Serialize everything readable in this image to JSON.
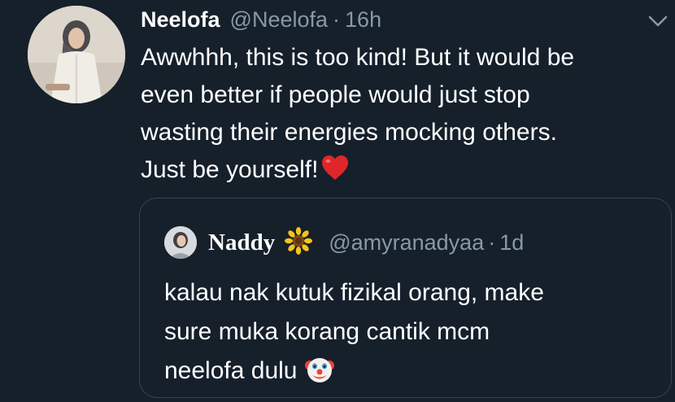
{
  "tweet": {
    "author_name": "Neelofa",
    "author_handle": "@Neelofa",
    "separator": "·",
    "time": "16h",
    "text_lines": [
      "Awwhhh, this is too kind! But it would be",
      "even better if people would just stop",
      "wasting their energies mocking others.",
      "Just be yourself!"
    ],
    "trailing_emoji": "heart-icon"
  },
  "quoted_tweet": {
    "author_name": "Naddy",
    "name_emoji": "sunflower-icon",
    "author_handle": "@amyranadyaa",
    "separator": "·",
    "time": "1d",
    "text_lines": [
      "kalau nak kutuk fizikal orang, make",
      "sure muka korang cantik mcm",
      "neelofa dulu"
    ],
    "trailing_emoji": "clown-icon"
  },
  "colors": {
    "background": "#15202b",
    "primary_text": "#ffffff",
    "secondary_text": "#8899a6",
    "border": "#38444d"
  },
  "icons": {
    "menu": "chevron-down-icon"
  }
}
